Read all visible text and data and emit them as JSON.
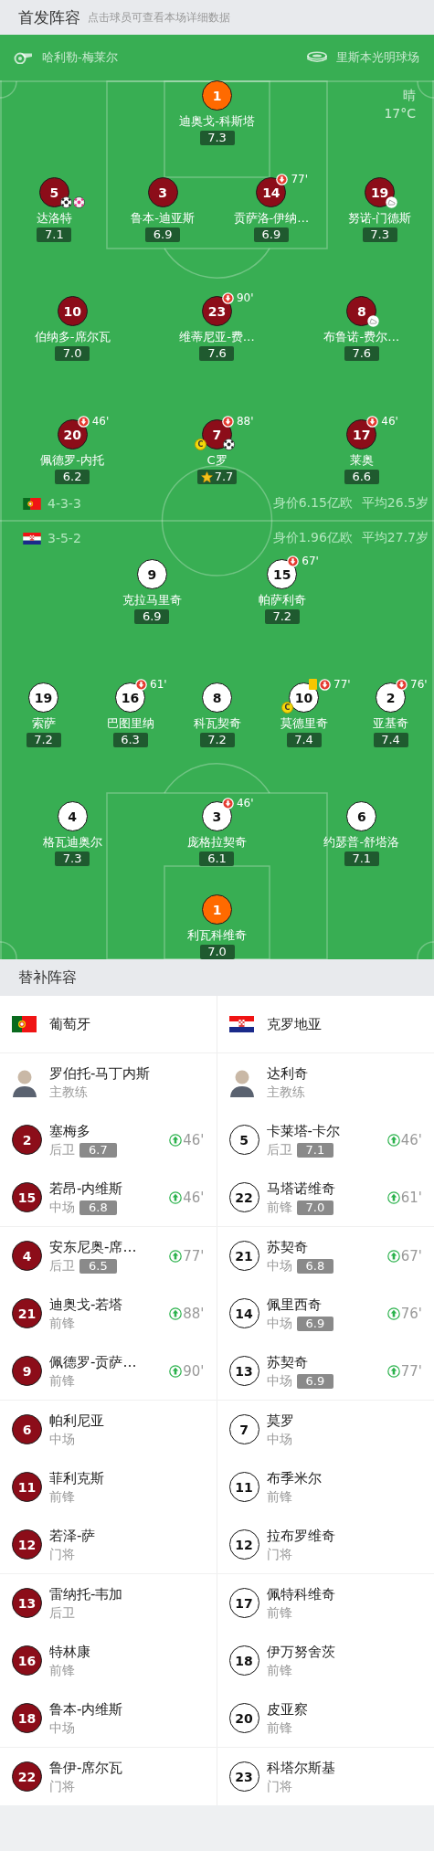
{
  "header": {
    "title": "首发阵容",
    "hint": "点击球员可查看本场详细数据"
  },
  "match_info": {
    "referee": "哈利勒-梅莱尔",
    "stadium": "里斯本光明球场",
    "weather": "晴",
    "temperature": "17°C"
  },
  "home": {
    "kind": "portugal",
    "formation": "4-3-3",
    "value": "身价6.15亿欧",
    "avg_age": "平均26.5岁",
    "lines": [
      [
        {
          "number": "1",
          "name": "迪奥戈-科斯塔",
          "rating": "7.3",
          "kind": "goalkeeper"
        }
      ],
      [
        {
          "number": "5",
          "name": "达洛特",
          "rating": "7.1",
          "kind": "outfield",
          "badges": [
            {
              "kind": "goal"
            },
            {
              "kind": "own_goal"
            }
          ]
        },
        {
          "number": "3",
          "name": "鲁本-迪亚斯",
          "rating": "6.9",
          "kind": "outfield"
        },
        {
          "number": "14",
          "name": "贡萨洛-伊纳…",
          "rating": "6.9",
          "kind": "outfield",
          "badges": [
            {
              "kind": "sub_off",
              "minute": "77'"
            }
          ]
        },
        {
          "number": "19",
          "name": "努诺-门德斯",
          "rating": "7.3",
          "kind": "outfield",
          "badges": [
            {
              "kind": "assist"
            }
          ]
        }
      ],
      [
        {
          "number": "10",
          "name": "伯纳多-席尔瓦",
          "rating": "7.0",
          "kind": "outfield"
        },
        {
          "number": "23",
          "name": "维蒂尼亚-费…",
          "rating": "7.6",
          "kind": "outfield",
          "badges": [
            {
              "kind": "sub_off",
              "minute": "90'"
            }
          ]
        },
        {
          "number": "8",
          "name": "布鲁诺-费尔…",
          "rating": "7.6",
          "kind": "outfield",
          "badges": [
            {
              "kind": "assist"
            }
          ]
        }
      ],
      [
        {
          "number": "20",
          "name": "佩德罗-内托",
          "rating": "6.2",
          "kind": "outfield",
          "badges": [
            {
              "kind": "sub_off",
              "minute": "46'"
            }
          ]
        },
        {
          "number": "7",
          "name": "C罗",
          "rating": "7.7",
          "kind": "outfield",
          "badges": [
            {
              "kind": "sub_off",
              "minute": "88'"
            },
            {
              "kind": "captain",
              "label": "C"
            },
            {
              "kind": "goal"
            },
            {
              "kind": "star"
            }
          ]
        },
        {
          "number": "17",
          "name": "莱奥",
          "rating": "6.6",
          "kind": "outfield",
          "badges": [
            {
              "kind": "sub_off",
              "minute": "46'"
            }
          ]
        }
      ]
    ]
  },
  "away": {
    "kind": "croatia",
    "formation": "3-5-2",
    "value": "身价1.96亿欧",
    "avg_age": "平均27.7岁",
    "lines": [
      [
        {
          "number": "9",
          "name": "克拉马里奇",
          "rating": "6.9",
          "kind": "outfield"
        },
        {
          "number": "15",
          "name": "帕萨利奇",
          "rating": "7.2",
          "kind": "outfield",
          "badges": [
            {
              "kind": "sub_off",
              "minute": "67'"
            }
          ]
        }
      ],
      [
        {
          "number": "19",
          "name": "索萨",
          "rating": "7.2",
          "kind": "outfield"
        },
        {
          "number": "16",
          "name": "巴图里纳",
          "rating": "6.3",
          "kind": "outfield",
          "badges": [
            {
              "kind": "sub_off",
              "minute": "61'"
            }
          ]
        },
        {
          "number": "8",
          "name": "科瓦契奇",
          "rating": "7.2",
          "kind": "outfield"
        },
        {
          "number": "10",
          "name": "莫德里奇",
          "rating": "7.4",
          "kind": "outfield",
          "badges": [
            {
              "kind": "yellow_card"
            },
            {
              "kind": "sub_off",
              "minute": "77'"
            },
            {
              "kind": "captain",
              "label": "C"
            }
          ]
        },
        {
          "number": "2",
          "name": "亚基奇",
          "rating": "7.4",
          "kind": "outfield",
          "badges": [
            {
              "kind": "sub_off",
              "minute": "76'"
            }
          ]
        }
      ],
      [
        {
          "number": "4",
          "name": "格瓦迪奥尔",
          "rating": "7.3",
          "kind": "outfield"
        },
        {
          "number": "3",
          "name": "庞格拉契奇",
          "rating": "6.1",
          "kind": "outfield",
          "badges": [
            {
              "kind": "sub_off",
              "minute": "46'"
            }
          ]
        },
        {
          "number": "6",
          "name": "约瑟普-舒塔洛",
          "rating": "7.1",
          "kind": "outfield"
        }
      ],
      [
        {
          "number": "1",
          "name": "利瓦科维奇",
          "rating": "7.0",
          "kind": "goalkeeper"
        }
      ]
    ]
  },
  "bench": {
    "title": "替补阵容",
    "teams": [
      {
        "name": "葡萄牙",
        "kind": "portugal"
      },
      {
        "name": "克罗地亚",
        "kind": "croatia"
      }
    ],
    "groups": [
      {
        "rows": [
          {
            "home": {
              "kind": "coach",
              "name": "罗伯托-马丁内斯",
              "role": "主教练"
            },
            "away": {
              "kind": "coach",
              "name": "达利奇",
              "role": "主教练"
            }
          },
          {
            "home": {
              "kind": "player",
              "number": "2",
              "name": "塞梅多",
              "role": "后卫",
              "rating": "6.7",
              "sub_on": "46'"
            },
            "away": {
              "kind": "player",
              "number": "5",
              "name": "卡莱塔-卡尔",
              "role": "后卫",
              "rating": "7.1",
              "sub_on": "46'"
            }
          },
          {
            "home": {
              "kind": "player",
              "number": "15",
              "name": "若昂-内维斯",
              "role": "中场",
              "rating": "6.8",
              "sub_on": "46'"
            },
            "away": {
              "kind": "player",
              "number": "22",
              "name": "马塔诺维奇",
              "role": "前锋",
              "rating": "7.0",
              "sub_on": "61'"
            }
          }
        ]
      },
      {
        "rows": [
          {
            "home": {
              "kind": "player",
              "number": "4",
              "name": "安东尼奥-席…",
              "role": "后卫",
              "rating": "6.5",
              "sub_on": "77'"
            },
            "away": {
              "kind": "player",
              "number": "21",
              "name": "苏契奇",
              "role": "中场",
              "rating": "6.8",
              "sub_on": "67'"
            }
          },
          {
            "home": {
              "kind": "player",
              "number": "21",
              "name": "迪奥戈-若塔",
              "role": "前锋",
              "sub_on": "88'"
            },
            "away": {
              "kind": "player",
              "number": "14",
              "name": "佩里西奇",
              "role": "中场",
              "rating": "6.9",
              "sub_on": "76'"
            }
          },
          {
            "home": {
              "kind": "player",
              "number": "9",
              "name": "佩德罗-贡萨…",
              "role": "前锋",
              "sub_on": "90'"
            },
            "away": {
              "kind": "player",
              "number": "13",
              "name": "苏契奇",
              "role": "中场",
              "rating": "6.9",
              "sub_on": "77'"
            }
          }
        ]
      },
      {
        "rows": [
          {
            "home": {
              "kind": "player",
              "number": "6",
              "name": "帕利尼亚",
              "role": "中场"
            },
            "away": {
              "kind": "player",
              "number": "7",
              "name": "莫罗",
              "role": "中场"
            }
          },
          {
            "home": {
              "kind": "player",
              "number": "11",
              "name": "菲利克斯",
              "role": "前锋"
            },
            "away": {
              "kind": "player",
              "number": "11",
              "name": "布季米尔",
              "role": "前锋"
            }
          },
          {
            "home": {
              "kind": "player",
              "number": "12",
              "name": "若泽-萨",
              "role": "门将"
            },
            "away": {
              "kind": "player",
              "number": "12",
              "name": "拉布罗维奇",
              "role": "门将"
            }
          }
        ]
      },
      {
        "rows": [
          {
            "home": {
              "kind": "player",
              "number": "13",
              "name": "雷纳托-韦加",
              "role": "后卫"
            },
            "away": {
              "kind": "player",
              "number": "17",
              "name": "佩特科维奇",
              "role": "前锋"
            }
          },
          {
            "home": {
              "kind": "player",
              "number": "16",
              "name": "特林康",
              "role": "前锋"
            },
            "away": {
              "kind": "player",
              "number": "18",
              "name": "伊万努舍茨",
              "role": "前锋"
            }
          },
          {
            "home": {
              "kind": "player",
              "number": "18",
              "name": "鲁本-内维斯",
              "role": "中场"
            },
            "away": {
              "kind": "player",
              "number": "20",
              "name": "皮亚察",
              "role": "前锋"
            }
          }
        ]
      },
      {
        "rows": [
          {
            "home": {
              "kind": "player",
              "number": "22",
              "name": "鲁伊-席尔瓦",
              "role": "门将"
            },
            "away": {
              "kind": "player",
              "number": "23",
              "name": "科塔尔斯基",
              "role": "门将"
            }
          }
        ]
      }
    ]
  }
}
